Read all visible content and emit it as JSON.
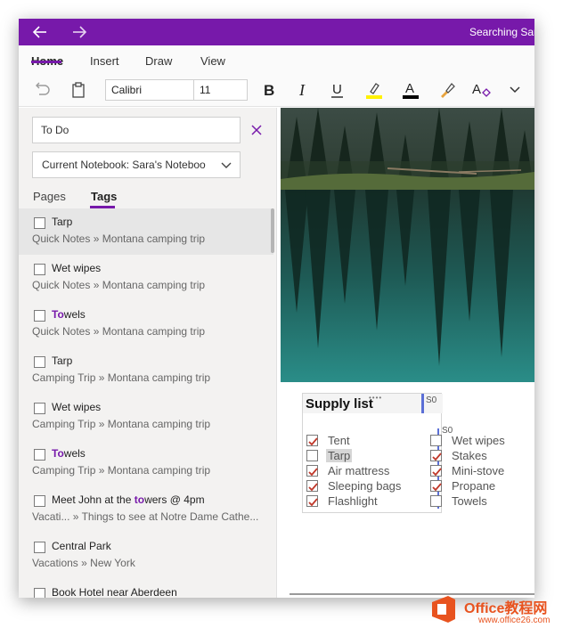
{
  "titlebar": {
    "title": "Searching Sar",
    "color": "#7719aa"
  },
  "ribbon": {
    "tabs": [
      {
        "label": "Home",
        "active": true
      },
      {
        "label": "Insert",
        "active": false
      },
      {
        "label": "Draw",
        "active": false
      },
      {
        "label": "View",
        "active": false
      }
    ],
    "font_name": "Calibri",
    "font_size": "11",
    "highlight_color": "#fff100",
    "font_color": "#000000"
  },
  "search": {
    "query": "To Do",
    "scope": "Current Notebook: Sara's Noteboo",
    "tabs": [
      {
        "label": "Pages",
        "active": false
      },
      {
        "label": "Tags",
        "active": true
      }
    ],
    "results": [
      {
        "pre": "",
        "hl": "",
        "post": "Tarp",
        "location": "Quick Notes » Montana camping trip",
        "selected": true
      },
      {
        "pre": "",
        "hl": "",
        "post": "Wet wipes",
        "location": "Quick Notes » Montana camping trip",
        "selected": false
      },
      {
        "pre": "",
        "hl": "To",
        "post": "wels",
        "location": "Quick Notes » Montana camping trip",
        "selected": false
      },
      {
        "pre": "",
        "hl": "",
        "post": "Tarp",
        "location": "Camping Trip » Montana camping trip",
        "selected": false
      },
      {
        "pre": "",
        "hl": "",
        "post": "Wet wipes",
        "location": "Camping Trip » Montana camping trip",
        "selected": false
      },
      {
        "pre": "",
        "hl": "To",
        "post": "wels",
        "location": "Camping Trip » Montana camping trip",
        "selected": false
      },
      {
        "pre": "Meet John at the ",
        "hl": "to",
        "post": "wers @ 4pm",
        "location": "Vacati... » Things to see at Notre Dame Cathe...",
        "selected": false
      },
      {
        "pre": "",
        "hl": "",
        "post": "Central Park",
        "location": "Vacations » New York",
        "selected": false
      },
      {
        "pre": "",
        "hl": "",
        "post": "Book Hotel near Aberdeen",
        "location": "",
        "selected": false
      }
    ]
  },
  "note": {
    "title": "Supply list",
    "col_marker": "S0",
    "col_marker_2": "S0",
    "left_items": [
      {
        "label": "Tent",
        "checked": true,
        "selected": false
      },
      {
        "label": "Tarp",
        "checked": false,
        "selected": true
      },
      {
        "label": "Air mattress",
        "checked": true,
        "selected": false
      },
      {
        "label": "Sleeping bags",
        "checked": true,
        "selected": false
      },
      {
        "label": "Flashlight",
        "checked": true,
        "selected": false
      }
    ],
    "right_items": [
      {
        "label": "Wet wipes",
        "checked": false
      },
      {
        "label": "Stakes",
        "checked": true
      },
      {
        "label": "Mini-stove",
        "checked": true
      },
      {
        "label": "Propane",
        "checked": true
      },
      {
        "label": "Towels",
        "checked": false
      }
    ]
  },
  "watermark": {
    "brand": "Office教程网",
    "url": "www.office26.com"
  }
}
